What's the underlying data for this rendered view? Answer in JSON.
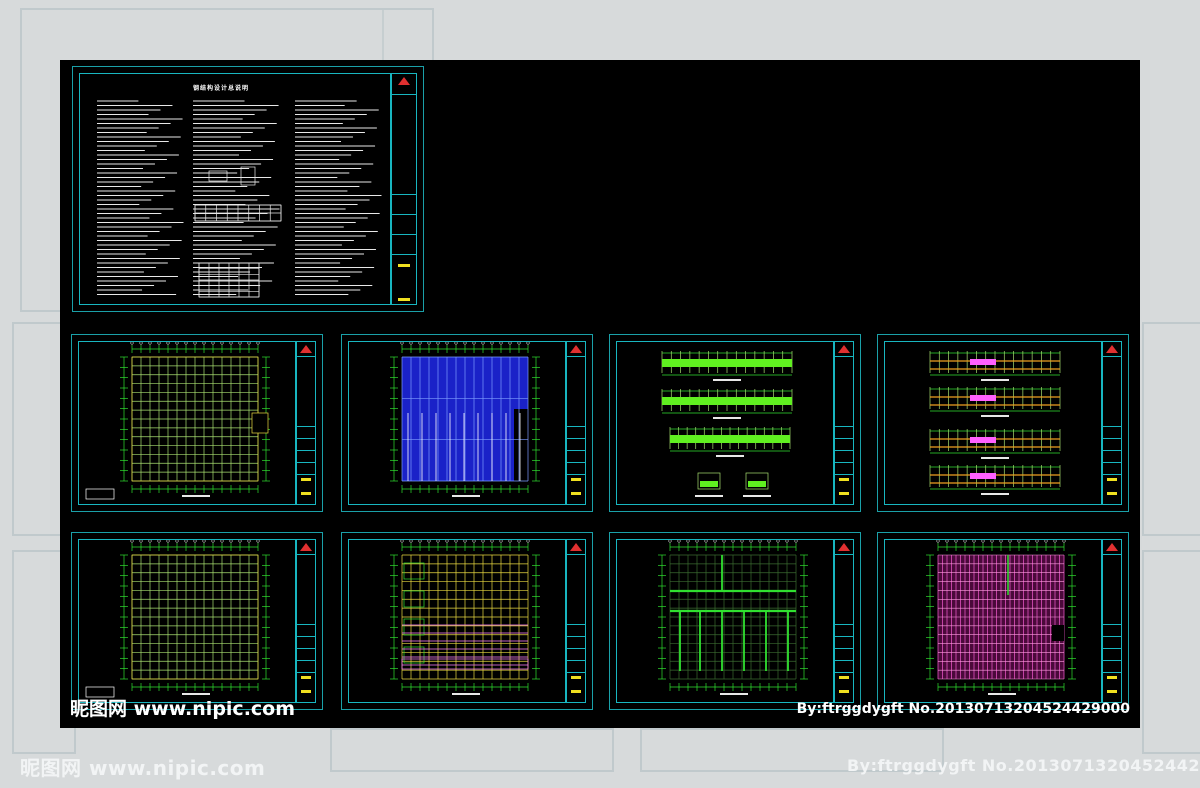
{
  "watermark": {
    "site": "昵图网 www.nipic.com",
    "author_id": "By:ftrggdygft No.20130713204524429000",
    "author_id_bg": "By:ftrggdygft No.2013071320452442"
  },
  "sheets": [
    {
      "id": "cover",
      "title": "钢结构设计总说明",
      "kind": "notes"
    },
    {
      "id": "s1",
      "kind": "grid-plan"
    },
    {
      "id": "s2",
      "kind": "roof-plan-blue"
    },
    {
      "id": "s3",
      "kind": "elevations-green"
    },
    {
      "id": "s4",
      "kind": "elevations-orange"
    },
    {
      "id": "s5",
      "kind": "grid-plan"
    },
    {
      "id": "s6",
      "kind": "purlin-plan"
    },
    {
      "id": "s7",
      "kind": "bracing-plan"
    },
    {
      "id": "s8",
      "kind": "roof-plan-magenta"
    }
  ],
  "colors": {
    "frame": "#18b6c0",
    "grid": "#a8e070",
    "axis": "#30e030",
    "blue": "#1a22c8",
    "magenta": "#e050c0",
    "yellow": "#e8d840",
    "logo": "#e03030"
  }
}
